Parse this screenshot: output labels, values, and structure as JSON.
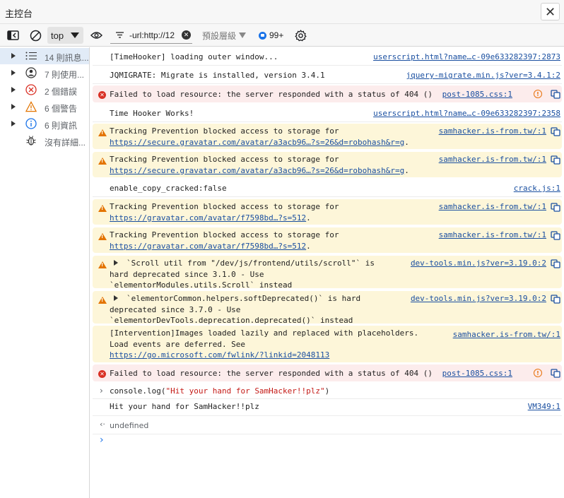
{
  "window": {
    "title": "主控台",
    "close_label": "✕"
  },
  "toolbar": {
    "context": "top",
    "filter_value": "-url:http://12",
    "levels_label": "預設層級",
    "issues_count": "99+"
  },
  "sidebar": {
    "items": [
      {
        "label": "14 則訊息...",
        "icon": "list-icon"
      },
      {
        "label": "7 則使用...",
        "icon": "user-icon"
      },
      {
        "label": "2 個錯誤",
        "icon": "error-icon"
      },
      {
        "label": "6 個警告",
        "icon": "warning-icon"
      },
      {
        "label": "6 則資訊",
        "icon": "info-icon"
      },
      {
        "label": "沒有詳細...",
        "icon": "bug-icon"
      }
    ]
  },
  "console": {
    "rows": [
      {
        "kind": "log",
        "text": "[TimeHooker] loading outer window...",
        "source": "userscript.html?name…c-09e633282397:2873"
      },
      {
        "kind": "log",
        "text": "JQMIGRATE: Migrate is installed, version 3.4.1",
        "source": "jquery-migrate.min.js?ver=3.4.1:2"
      },
      {
        "kind": "error",
        "text": "Failed to load resource: the server responded with a status of 404 ()",
        "source": "post-1085.css:1"
      },
      {
        "kind": "log",
        "text": "Time Hooker Works!",
        "source": "userscript.html?name…c-09e633282397:2358"
      },
      {
        "kind": "warning",
        "text": "Tracking Prevention blocked access to storage for",
        "link": "https://secure.gravatar.com/avatar/a3acb96…?s=26&d=robohash&r=g",
        "source": "samhacker.is-from.tw/:1"
      },
      {
        "kind": "warning",
        "text": "Tracking Prevention blocked access to storage for",
        "link": "https://secure.gravatar.com/avatar/a3acb96…?s=26&d=robohash&r=g",
        "source": "samhacker.is-from.tw/:1"
      },
      {
        "kind": "log",
        "text": "enable_copy_cracked:false",
        "source": "crack.js:1"
      },
      {
        "kind": "warning",
        "text": "Tracking Prevention blocked access to storage for",
        "link": "https://gravatar.com/avatar/f7598bd…?s=512",
        "source": "samhacker.is-from.tw/:1"
      },
      {
        "kind": "warning",
        "text": "Tracking Prevention blocked access to storage for",
        "link": "https://gravatar.com/avatar/f7598bd…?s=512",
        "source": "samhacker.is-from.tw/:1"
      },
      {
        "kind": "warning",
        "line1": "`Scroll util from \"/dev/js/frontend/utils/scroll\"` is",
        "line2": "hard deprecated since 3.1.0 - Use",
        "line3": "`elementorModules.utils.Scroll` instead",
        "source": "dev-tools.min.js?ver=3.19.0:2"
      },
      {
        "kind": "warning",
        "line1": "`elementorCommon.helpers.softDeprecated()` is hard",
        "line2": "deprecated since 3.7.0 - Use",
        "line3": "`elementorDevTools.deprecation.deprecated()` instead",
        "source": "dev-tools.min.js?ver=3.19.0:2"
      },
      {
        "kind": "intervention",
        "line1": "[Intervention]Images loaded lazily and replaced with placeholders.",
        "line2": "Load events are deferred. See",
        "link": "https://go.microsoft.com/fwlink/?linkid=2048113",
        "source": "samhacker.is-from.tw/:1"
      },
      {
        "kind": "error",
        "text": "Failed to load resource: the server responded with a status of 404 ()",
        "source": "post-1085.css:1"
      },
      {
        "kind": "command",
        "prefix": "console.log(",
        "arg": "\"Hit your hand for SamHacker!!plz\"",
        "suffix": ")"
      },
      {
        "kind": "log",
        "text": "Hit your hand for SamHacker!!plz",
        "source": "VM349:1"
      },
      {
        "kind": "result",
        "text": "undefined"
      }
    ]
  }
}
